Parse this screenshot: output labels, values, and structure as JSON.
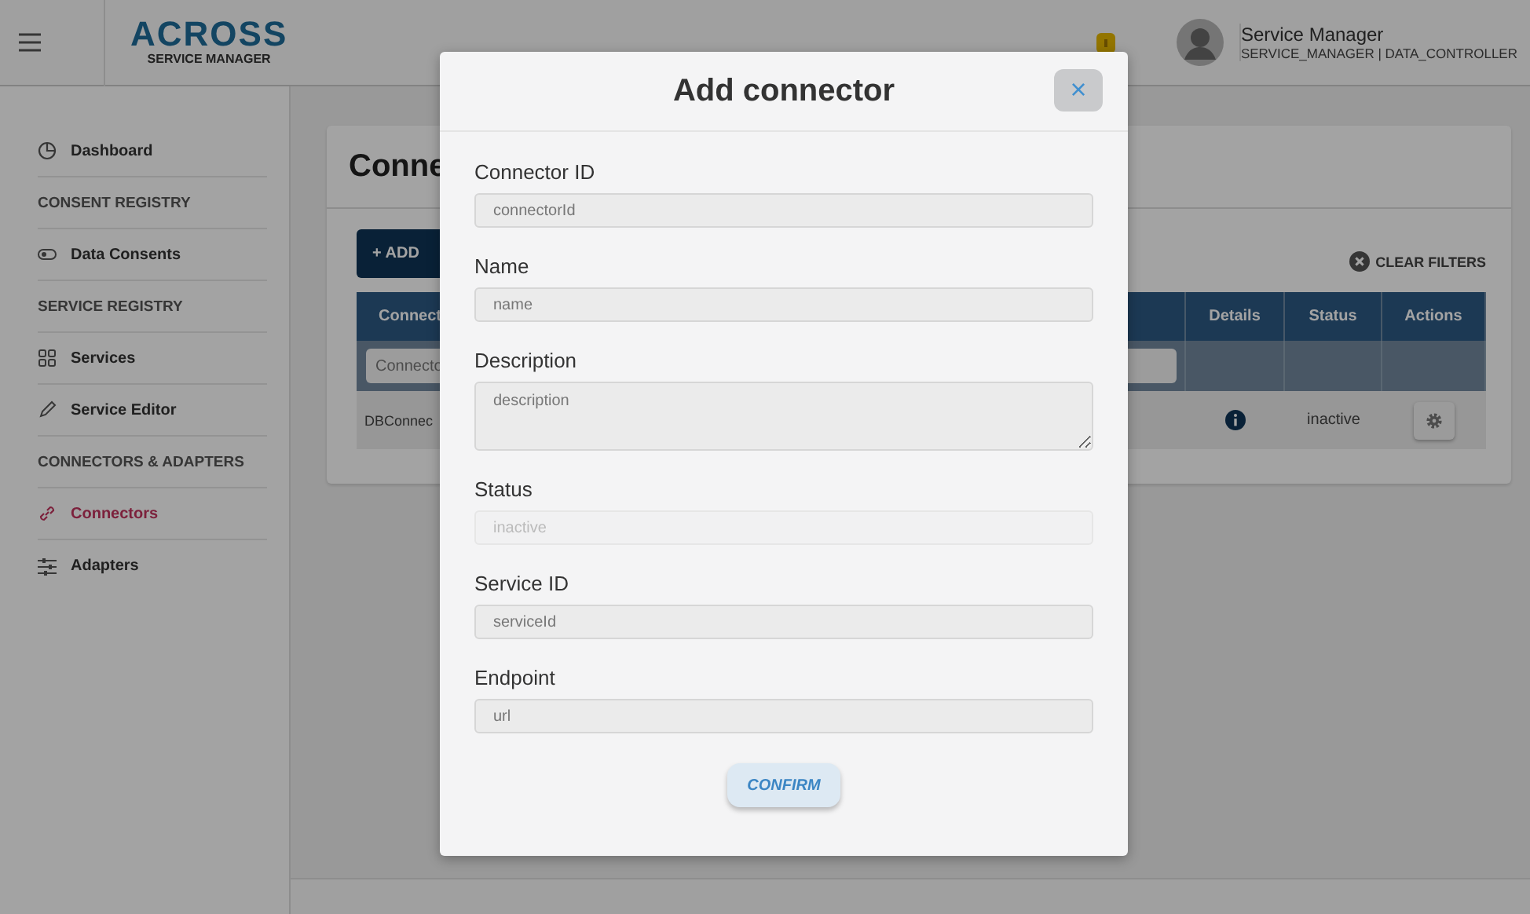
{
  "header": {
    "logo_title": "ACROSS",
    "logo_subtitle": "SERVICE MANAGER",
    "user_name": "Service Manager",
    "user_roles": "SERVICE_MANAGER | DATA_CONTROLLER"
  },
  "sidebar": {
    "items": [
      {
        "kind": "link",
        "label": "Dashboard",
        "selected": false
      },
      {
        "kind": "section",
        "label": "CONSENT REGISTRY"
      },
      {
        "kind": "link",
        "label": "Data Consents",
        "selected": false
      },
      {
        "kind": "section",
        "label": "SERVICE REGISTRY"
      },
      {
        "kind": "link",
        "label": "Services",
        "selected": false
      },
      {
        "kind": "link",
        "label": "Service Editor",
        "selected": false
      },
      {
        "kind": "section",
        "label": "CONNECTORS & ADAPTERS"
      },
      {
        "kind": "link",
        "label": "Connectors",
        "selected": true
      },
      {
        "kind": "link",
        "label": "Adapters",
        "selected": false
      }
    ]
  },
  "page": {
    "title": "Conne",
    "add_button": "+ ADD",
    "clear_filters": "CLEAR FILTERS",
    "table": {
      "columns": [
        "Connect",
        "Details",
        "Status",
        "Actions"
      ],
      "filter_placeholder": "Connecto",
      "rows": [
        {
          "column_1": "DBConnec",
          "status": "inactive"
        }
      ]
    }
  },
  "modal": {
    "title": "Add connector",
    "close": "×",
    "fields": [
      {
        "kind": "input",
        "label": "Connector ID",
        "placeholder": "connectorId",
        "disabled": false
      },
      {
        "kind": "input",
        "label": "Name",
        "placeholder": "name",
        "disabled": false
      },
      {
        "kind": "textarea",
        "label": "Description",
        "placeholder": "description",
        "disabled": false
      },
      {
        "kind": "input",
        "label": "Status",
        "value": "inactive",
        "disabled": true
      },
      {
        "kind": "input",
        "label": "Service ID",
        "placeholder": "serviceId",
        "disabled": false
      },
      {
        "kind": "input",
        "label": "Endpoint",
        "placeholder": "url",
        "disabled": false
      }
    ],
    "confirm": "CONFIRM"
  }
}
